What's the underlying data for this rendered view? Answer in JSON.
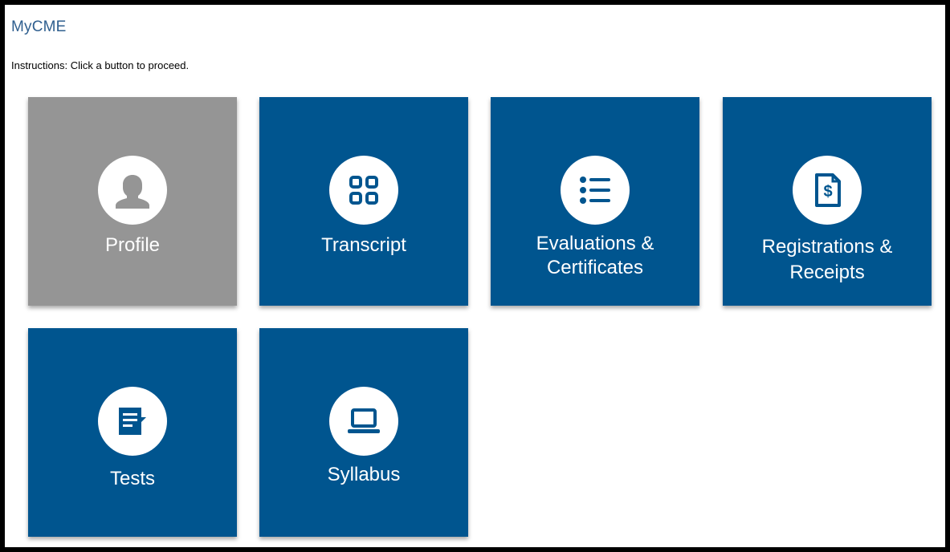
{
  "header": {
    "title": "MyCME",
    "instructions": "Instructions: Click a button to proceed."
  },
  "tiles": [
    {
      "label": "Profile",
      "icon": "person-icon",
      "color": "#959595",
      "selected": true
    },
    {
      "label": "Transcript",
      "icon": "grid-icon",
      "color": "#00558f"
    },
    {
      "label_lines": [
        "Evaluations &",
        "Certificates"
      ],
      "icon": "list-icon",
      "color": "#00558f"
    },
    {
      "label_lines": [
        "Registrations &",
        "Receipts"
      ],
      "icon": "dollar-document-icon",
      "color": "#00558f"
    },
    {
      "label": "Tests",
      "icon": "document-icon",
      "color": "#00558f"
    },
    {
      "label": "Syllabus",
      "icon": "laptop-icon",
      "color": "#00558f"
    }
  ],
  "colors": {
    "tile_blue": "#00558f",
    "tile_gray": "#959595",
    "title_blue": "#2f5f8f"
  }
}
